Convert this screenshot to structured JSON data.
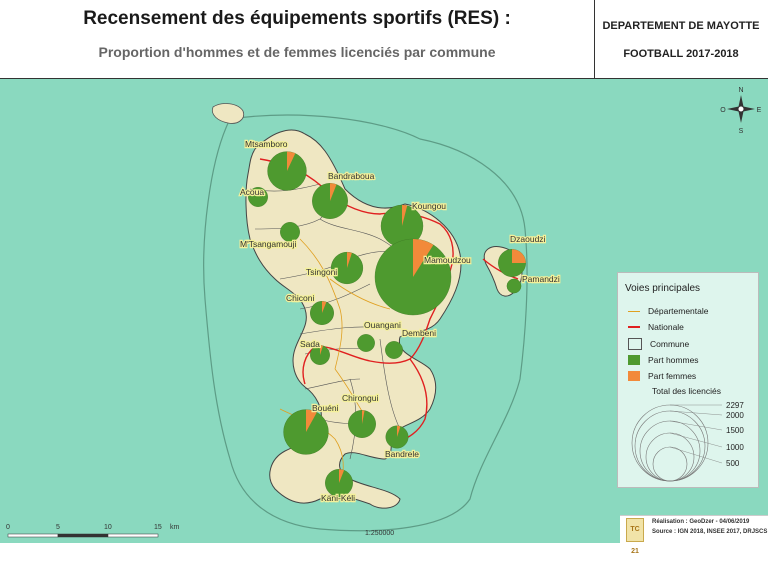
{
  "header": {
    "title": "Recensement des équipements sportifs (RES) :",
    "subtitle": "Proportion d'hommes et de femmes licenciés par commune",
    "department": "DEPARTEMENT DE MAYOTTE",
    "season": "FOOTBALL 2017-2018"
  },
  "communes": [
    {
      "name": "Mtsamboro",
      "total": 600,
      "femmes_pct": 0.07
    },
    {
      "name": "Acoua",
      "total": 150,
      "femmes_pct": 0.0
    },
    {
      "name": "Bandraboua",
      "total": 500,
      "femmes_pct": 0.06
    },
    {
      "name": "M'Tsangamouji",
      "total": 150,
      "femmes_pct": 0.0
    },
    {
      "name": "Koungou",
      "total": 700,
      "femmes_pct": 0.04
    },
    {
      "name": "Tsingoni",
      "total": 400,
      "femmes_pct": 0.05
    },
    {
      "name": "Mamoudzou",
      "total": 2297,
      "femmes_pct": 0.09
    },
    {
      "name": "Dzaoudzi",
      "total": 300,
      "femmes_pct": 0.25
    },
    {
      "name": "Pamandzi",
      "total": 80,
      "femmes_pct": 0.0
    },
    {
      "name": "Chiconi",
      "total": 220,
      "femmes_pct": 0.06
    },
    {
      "name": "Ouangani",
      "total": 120,
      "femmes_pct": 0.0
    },
    {
      "name": "Dembeni",
      "total": 120,
      "femmes_pct": 0.0
    },
    {
      "name": "Sada",
      "total": 150,
      "femmes_pct": 0.05
    },
    {
      "name": "Chirongui",
      "total": 300,
      "femmes_pct": 0.03
    },
    {
      "name": "Bouéni",
      "total": 800,
      "femmes_pct": 0.08
    },
    {
      "name": "Bandrele",
      "total": 200,
      "femmes_pct": 0.05
    },
    {
      "name": "Kani-Kéli",
      "total": 300,
      "femmes_pct": 0.06
    }
  ],
  "legend": {
    "title": "Voies principales",
    "departementale": "Départementale",
    "nationale": "Nationale",
    "commune": "Commune",
    "hommes": "Part hommes",
    "femmes": "Part femmes",
    "total": "Total des licenciés",
    "sizes": [
      "2297",
      "2000",
      "1500",
      "1000",
      "500"
    ]
  },
  "scale": {
    "ticks": [
      "0",
      "5",
      "10",
      "15"
    ],
    "unit": "km",
    "ratio": "1:250000"
  },
  "credits": {
    "line1": "Réalisation : GeoDzer - 04/06/2019",
    "line2": "Source : IGN 2018, INSEE 2017, DRJSCS",
    "logo": "TC 21"
  },
  "colors": {
    "sea": "#8ad9bf",
    "land": "#efe7c2",
    "hommes": "#4e9a2f",
    "femmes": "#f28a3a",
    "nationale": "#e02020",
    "departementale": "#e0a020"
  }
}
